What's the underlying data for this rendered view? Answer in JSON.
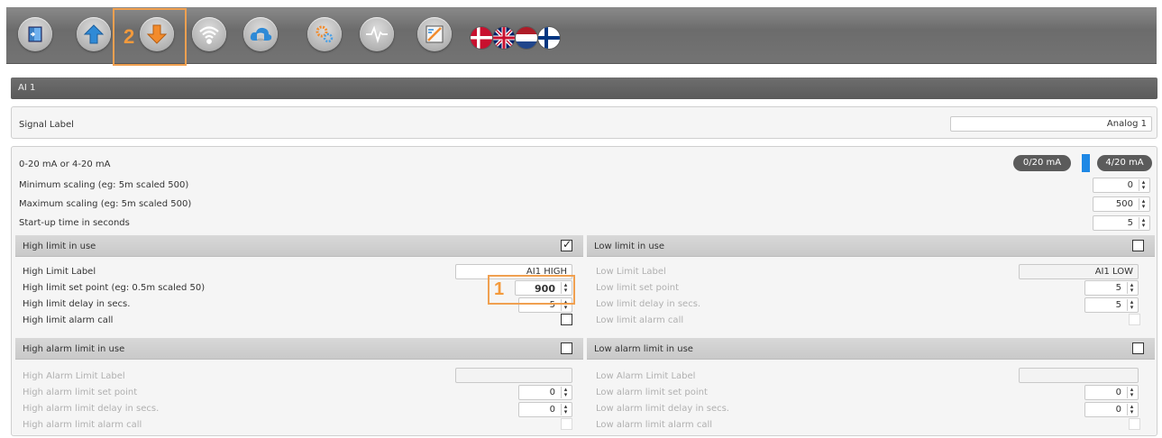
{
  "toolbar": {
    "icons": [
      "exit-door-icon",
      "upload-arrow-icon",
      "download-arrow-icon",
      "wifi-icon",
      "cloud-database-icon",
      "gears-icon",
      "signal-wave-icon",
      "chart-edit-icon"
    ],
    "flags": [
      "flag-denmark-icon",
      "flag-uk-icon",
      "flag-netherlands-icon",
      "flag-finland-icon"
    ],
    "callout_2": "2"
  },
  "section_title": "AI 1",
  "signal_label": {
    "label": "Signal Label",
    "value": "Analog 1"
  },
  "config": {
    "mode_label": "0-20 mA or 4-20 mA",
    "mode_options": [
      "0/20 mA",
      "4/20 mA"
    ],
    "min_label": "Minimum scaling (eg: 5m scaled 500)",
    "min_value": "0",
    "max_label": "Maximum scaling (eg: 5m scaled 500)",
    "max_value": "500",
    "startup_label": "Start-up time in seconds",
    "startup_value": "5"
  },
  "high_limit": {
    "title": "High limit in use",
    "checked": true,
    "label_label": "High Limit Label",
    "label_value": "AI1 HIGH",
    "setpoint_label": "High limit set point (eg: 0.5m scaled 50)",
    "setpoint_value": "900",
    "delay_label": "High limit delay in secs.",
    "delay_value": "5",
    "alarm_label": "High limit alarm call"
  },
  "low_limit": {
    "title": "Low limit in use",
    "label_label": "Low Limit Label",
    "label_value": "AI1 LOW",
    "setpoint_label": "Low limit set point",
    "setpoint_value": "5",
    "delay_label": "Low limit delay in secs.",
    "delay_value": "5",
    "alarm_label": "Low limit alarm call"
  },
  "high_alarm": {
    "title": "High alarm limit in use",
    "label_label": "High Alarm Limit Label",
    "setpoint_label": "High alarm limit set point",
    "setpoint_value": "0",
    "delay_label": "High alarm limit delay in secs.",
    "delay_value": "0",
    "alarm_label": "High alarm limit alarm call"
  },
  "low_alarm": {
    "title": "Low alarm limit in use",
    "label_label": "Low Alarm Limit Label",
    "setpoint_label": "Low alarm limit set point",
    "setpoint_value": "0",
    "delay_label": "Low alarm limit delay in secs.",
    "delay_value": "0",
    "alarm_label": "Low alarm limit alarm call"
  },
  "callout_1": "1",
  "colors": {
    "accent_blue": "#1e88e5",
    "callout_orange": "#f39a3c"
  }
}
